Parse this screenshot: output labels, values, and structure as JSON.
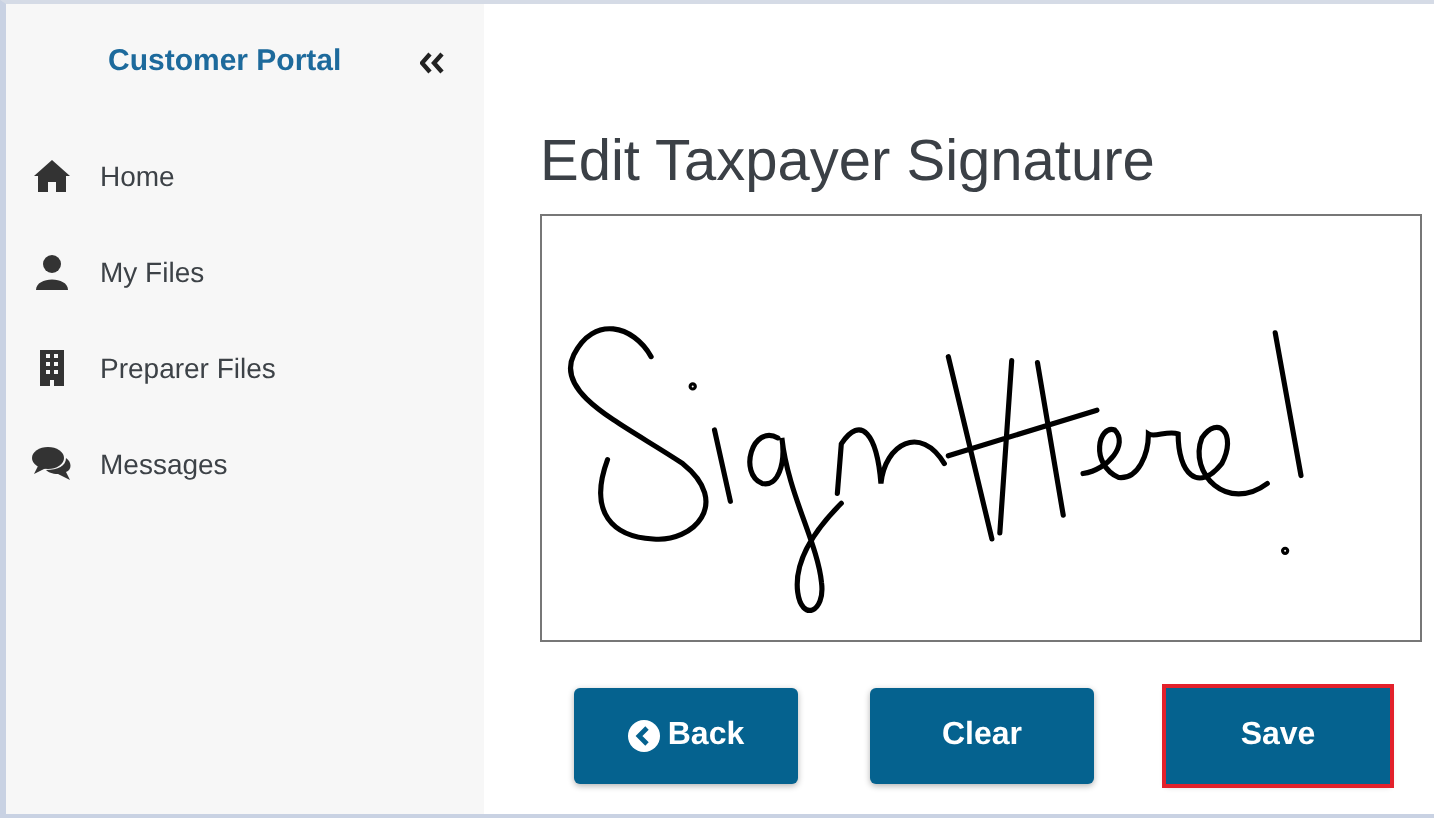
{
  "sidebar": {
    "title": "Customer Portal",
    "items": [
      {
        "label": "Home",
        "kind": "home"
      },
      {
        "label": "My Files",
        "kind": "user"
      },
      {
        "label": "Preparer Files",
        "kind": "building"
      },
      {
        "label": "Messages",
        "kind": "comments"
      }
    ]
  },
  "main": {
    "heading": "Edit Taxpayer Signature",
    "buttons": [
      {
        "label": "Back",
        "kind": "back",
        "focused": false
      },
      {
        "label": "Clear",
        "kind": "plain",
        "focused": false
      },
      {
        "label": "Save",
        "kind": "plain",
        "focused": true
      }
    ]
  }
}
